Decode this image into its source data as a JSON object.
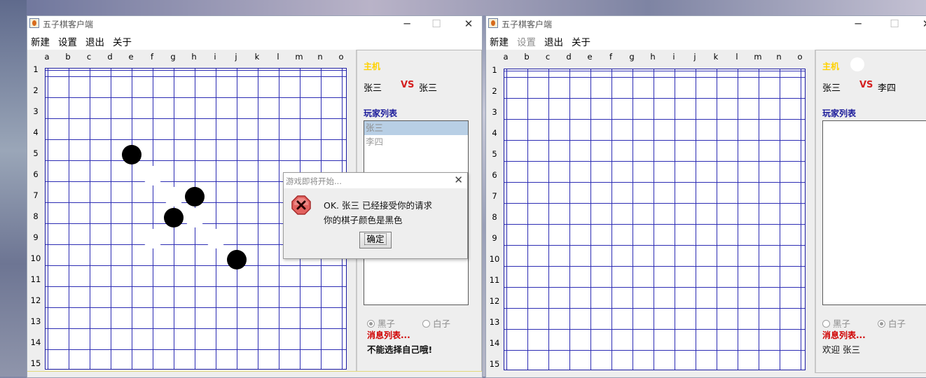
{
  "left_window": {
    "title": "五子棋客户端",
    "controls": {
      "minimize": "─",
      "maximize": "☐",
      "close": "✕"
    },
    "menu": [
      {
        "label": "新建",
        "enabled": true
      },
      {
        "label": "设置",
        "enabled": true
      },
      {
        "label": "退出",
        "enabled": true
      },
      {
        "label": "关于",
        "enabled": true
      }
    ],
    "columns": [
      "a",
      "b",
      "c",
      "d",
      "e",
      "f",
      "g",
      "h",
      "i",
      "j",
      "k",
      "l",
      "m",
      "n",
      "o"
    ],
    "rows": [
      "1",
      "2",
      "3",
      "4",
      "5",
      "6",
      "7",
      "8",
      "9",
      "10",
      "11",
      "12",
      "13",
      "14",
      "15"
    ],
    "stones": [
      {
        "color": "black",
        "col": "e",
        "row": 5
      },
      {
        "color": "white",
        "col": "f",
        "row": 6
      },
      {
        "color": "white",
        "col": "g",
        "row": 7
      },
      {
        "color": "black",
        "col": "h",
        "row": 7
      },
      {
        "color": "black",
        "col": "g",
        "row": 8
      },
      {
        "color": "white",
        "col": "h",
        "row": 8
      },
      {
        "color": "white",
        "col": "f",
        "row": 9
      },
      {
        "color": "white",
        "col": "i",
        "row": 9
      },
      {
        "color": "black",
        "col": "j",
        "row": 10
      }
    ],
    "panel": {
      "host_label": "主机",
      "player1": "张三",
      "vs": "VS",
      "player2": "张三",
      "player_list_label": "玩家列表",
      "players": [
        {
          "name": "张三",
          "selected": true
        },
        {
          "name": "李四",
          "selected": false
        }
      ],
      "radio_black": "黑子",
      "radio_white": "白子",
      "selected_color": "black",
      "message_list_label": "消息列表...",
      "message": "不能选择自己哦!"
    }
  },
  "right_window": {
    "title": "五子棋客户端",
    "controls": {
      "minimize": "─",
      "maximize": "☐",
      "close": "✕"
    },
    "menu": [
      {
        "label": "新建",
        "enabled": true
      },
      {
        "label": "设置",
        "enabled": false
      },
      {
        "label": "退出",
        "enabled": true
      },
      {
        "label": "关于",
        "enabled": true
      }
    ],
    "columns": [
      "a",
      "b",
      "c",
      "d",
      "e",
      "f",
      "g",
      "h",
      "i",
      "j",
      "k",
      "l",
      "m",
      "n",
      "o"
    ],
    "rows": [
      "1",
      "2",
      "3",
      "4",
      "5",
      "6",
      "7",
      "8",
      "9",
      "10",
      "11",
      "12",
      "13",
      "14",
      "15"
    ],
    "panel": {
      "host_label": "主机",
      "host_stone": "white",
      "player1": "张三",
      "vs": "VS",
      "player2": "李四",
      "player_list_label": "玩家列表",
      "radio_black": "黑子",
      "radio_white": "白子",
      "selected_color": "white",
      "message_list_label": "消息列表...",
      "message": "欢迎 张三"
    }
  },
  "dialog": {
    "title": "游戏即将开始...",
    "close": "✕",
    "icon": "error-icon",
    "line1": "OK. 张三 已经接受你的请求",
    "line2": "你的棋子颜色是黑色",
    "ok_label": "确定"
  },
  "colors": {
    "grid": "#2c2cb4",
    "host_label": "#ffd200",
    "vs": "#d42020",
    "message_label": "#d00000",
    "player_list_label": "#1a1a9a"
  }
}
